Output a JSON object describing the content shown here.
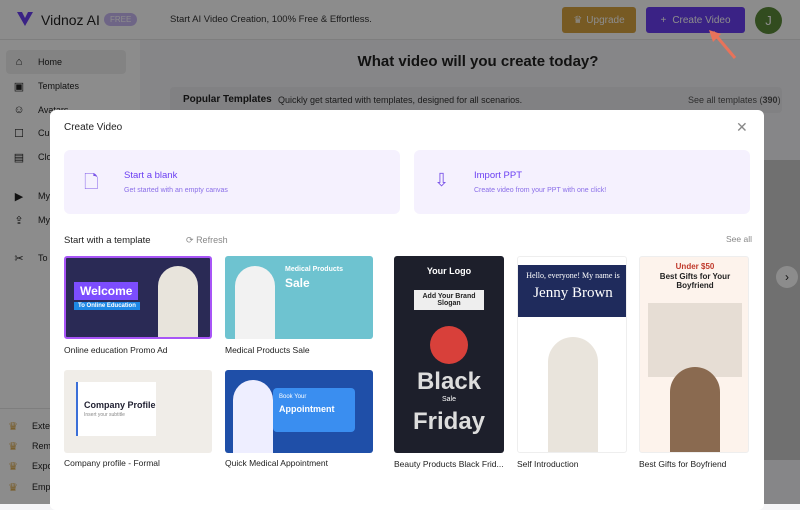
{
  "header": {
    "brand": "Vidnoz AI",
    "badge": "FREE",
    "slogan": "Start AI Video Creation, 100% Free & Effortless.",
    "upgrade": "Upgrade",
    "create_video": "Create Video",
    "avatar_initial": "J"
  },
  "sidebar": {
    "items": [
      {
        "label": "Home",
        "icon": "home-icon"
      },
      {
        "label": "Templates",
        "icon": "templates-icon"
      },
      {
        "label": "Avatars",
        "icon": "avatar-icon"
      },
      {
        "label": "Cu",
        "icon": "custom-icon"
      },
      {
        "label": "Clo",
        "icon": "clone-icon"
      },
      {
        "label": "My",
        "icon": "play-icon"
      },
      {
        "label": "My",
        "icon": "upload-icon"
      },
      {
        "label": "To",
        "icon": "tools-icon"
      }
    ],
    "premium": [
      "Extend",
      "Remove",
      "Export",
      "Emplo"
    ]
  },
  "main": {
    "title": "What video will you create today?",
    "popular": "Popular Templates",
    "popular_desc": "Quickly get started with templates, designed for all scenarios.",
    "see_all_templates": "See all templates (",
    "count": "390",
    "close_paren": ")"
  },
  "modal": {
    "title": "Create Video",
    "options": [
      {
        "title": "Start a blank",
        "desc": "Get started with an empty canvas"
      },
      {
        "title": "Import PPT",
        "desc": "Create video from your PPT with one click!"
      }
    ],
    "section": "Start with a template",
    "refresh": "Refresh",
    "see_all": "See all",
    "templates": [
      {
        "label": "Online education Promo Ad",
        "thumb": "Welcome",
        "thumb_sub": "To Online Education"
      },
      {
        "label": "Medical Products Sale",
        "thumb": "Medical Products",
        "thumb_sub": "Sale"
      },
      {
        "label": "Company profile - Formal",
        "thumb": "Company Profile",
        "thumb_sub": "Insert your subtitle"
      },
      {
        "label": "Quick Medical Appointment",
        "thumb": "Book Your",
        "thumb_sub": "Appointment"
      },
      {
        "label": "Beauty Products Black Frid...",
        "thumb": "Your Logo",
        "thumb_sub": "Add Your Brand Slogan",
        "thumb_big": "Black",
        "thumb_sale": "Sale",
        "thumb_big2": "Friday"
      },
      {
        "label": "Self Introduction",
        "thumb": "Hello, everyone! My name is",
        "thumb_sub": "Jenny Brown"
      },
      {
        "label": "Best Gifts for Boyfriend",
        "thumb": "Under $50",
        "thumb_sub": "Best Gifts for Your Boyfriend"
      }
    ]
  },
  "colors": {
    "accent": "#6b3ff2",
    "gold": "#d9a441",
    "option_bg": "#f5f1fe"
  }
}
